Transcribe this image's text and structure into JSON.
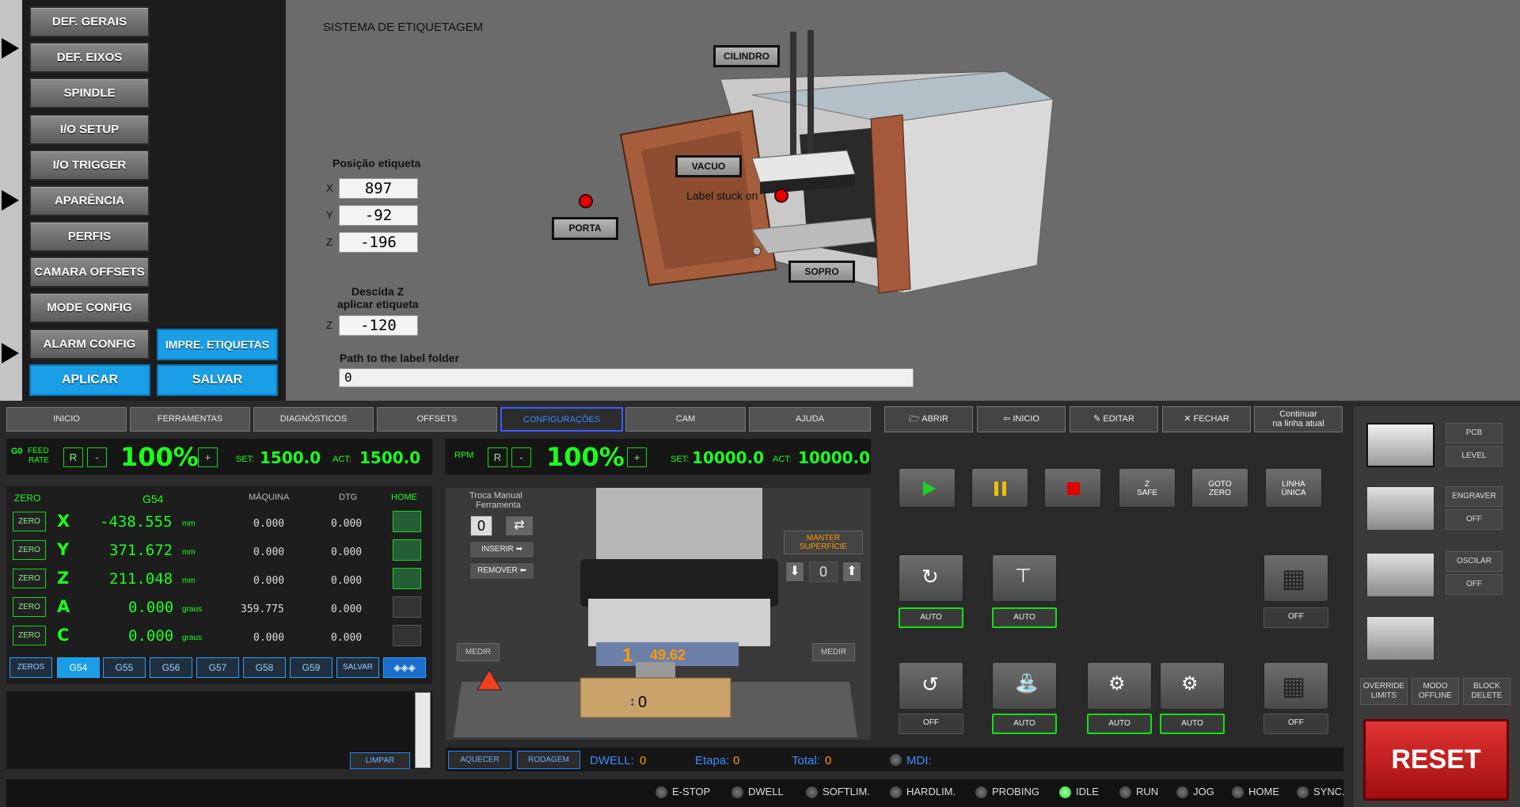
{
  "menu": {
    "items": [
      "DEF. GERAIS",
      "DEF. EIXOS",
      "SPINDLE",
      "I/O SETUP",
      "I/O TRIGGER",
      "APARÊNCIA",
      "PERFIS",
      "CAMARA OFFSETS",
      "MODE CONFIG",
      "ALARM CONFIG"
    ],
    "impre_label": "IMPRE. ETIQUETAS",
    "aplicar_label": "APLICAR",
    "salvar_label": "SALVAR"
  },
  "settings": {
    "title": "SISTEMA DE ETIQUETAGEM",
    "pos_label": "Posição etiqueta",
    "x_label": "X",
    "x_value": "897",
    "y_label": "Y",
    "y_value": "-92",
    "z_label": "Z",
    "z_value": "-196",
    "descida_label1": "Descida Z",
    "descida_label2": "aplicar etiqueta",
    "descida_z_label": "Z",
    "descida_value": "-120",
    "path_label": "Path to the label folder",
    "path_value": "0",
    "tags": {
      "cilindro": "CILINDRO",
      "vacuo": "VACUO",
      "porta": "PORTA",
      "sopro": "SOPRO"
    },
    "stuck_label": "Label stuck on"
  },
  "tabs": [
    "INICIO",
    "FERRAMENTAS",
    "DIAGNÓSTICOS",
    "OFFSETS",
    "CONFIGURAÇÕES",
    "CAM",
    "AJUDA"
  ],
  "filebar": [
    "ABRIR",
    "INICIO",
    "EDITAR",
    "FECHAR"
  ],
  "continuar": [
    "Continuar",
    "na linha atual"
  ],
  "feed": {
    "g0": "G0",
    "l1": "FEED",
    "l2": "RATE",
    "r": "R",
    "minus": "-",
    "plus": "+",
    "pct": "100%",
    "set_label": "SET:",
    "set": "1500.0",
    "act_label": "ACT:",
    "act": "1500.0"
  },
  "rpm": {
    "label": "RPM",
    "r": "R",
    "minus": "-",
    "plus": "+",
    "pct": "100%",
    "set_label": "SET:",
    "set": "10000.0",
    "act_label": "ACT:",
    "act": "10000.0"
  },
  "dro": {
    "headers": {
      "zero": "ZERO",
      "g": "G54",
      "maq": "MÁQUINA",
      "dtg": "DTG",
      "home": "HOME"
    },
    "zero_btn": "ZERO",
    "axes": [
      {
        "name": "X",
        "value": "-438.555",
        "unit": "mm",
        "maq": "0.000",
        "dtg": "0.000"
      },
      {
        "name": "Y",
        "value": "371.672",
        "unit": "mm",
        "maq": "0.000",
        "dtg": "0.000"
      },
      {
        "name": "Z",
        "value": "211.048",
        "unit": "mm",
        "maq": "0.000",
        "dtg": "0.000"
      },
      {
        "name": "A",
        "value": "0.000",
        "unit": "graus",
        "maq": "359.775",
        "dtg": "0.000"
      },
      {
        "name": "C",
        "value": "0.000",
        "unit": "graus",
        "maq": "0.000",
        "dtg": "0.000"
      }
    ],
    "wcs": [
      "ZEROS",
      "G54",
      "G55",
      "G56",
      "G57",
      "G58",
      "G59",
      "SALVAR"
    ]
  },
  "console": {
    "limpar": "LIMPAR"
  },
  "tool": {
    "troca1": "Troca Manual",
    "troca2": "Ferramenta",
    "tool_num": "0",
    "inserir": "INSERIR",
    "remover": "REMOVER",
    "manter1": "MANTER",
    "manter2": "SUPERFÍCIE",
    "manter_val": "0",
    "medir": "MEDIR",
    "tool_current": "1",
    "tool_len": "49.62",
    "z_val": "0"
  },
  "bottombar": {
    "aquecer": "AQUECER",
    "rodagem": "RODAGEM",
    "dwell_label": "DWELL:",
    "dwell": "0",
    "etapa_label": "Etapa:",
    "etapa": "0",
    "total_label": "Total:",
    "total": "0",
    "mdi": "MDI:"
  },
  "controls": {
    "zsafe1": "Z",
    "zsafe2": "SAFE",
    "goto1": "GOTO",
    "goto2": "ZERO",
    "linha1": "LINHA",
    "linha2": "ÚNICA"
  },
  "pills": {
    "auto": "AUTO",
    "off": "OFF"
  },
  "right": {
    "pcb": "PCB",
    "level": "LEVEL",
    "engraver": "ENGRAVER",
    "off": "OFF",
    "oscilar": "OSCILAR",
    "override1": "OVERRIDE",
    "override2": "LIMITS",
    "modo1": "MODO",
    "modo2": "OFFLINE",
    "block1": "BLOCK",
    "block2": "DELETE",
    "reset": "RESET"
  },
  "status": [
    {
      "label": "E-STOP",
      "on": false
    },
    {
      "label": "DWELL",
      "on": false
    },
    {
      "label": "SOFTLIM.",
      "on": false
    },
    {
      "label": "HARDLIM.",
      "on": false
    },
    {
      "label": "PROBING",
      "on": false
    },
    {
      "label": "IDLE",
      "on": true
    },
    {
      "label": "RUN",
      "on": false
    },
    {
      "label": "JOG",
      "on": false
    },
    {
      "label": "HOME",
      "on": false
    },
    {
      "label": "SYNC.",
      "on": false
    }
  ],
  "colors": {
    "accent": "#1a9ee6",
    "green": "#1cff1c",
    "reset": "#cc1a1a"
  }
}
